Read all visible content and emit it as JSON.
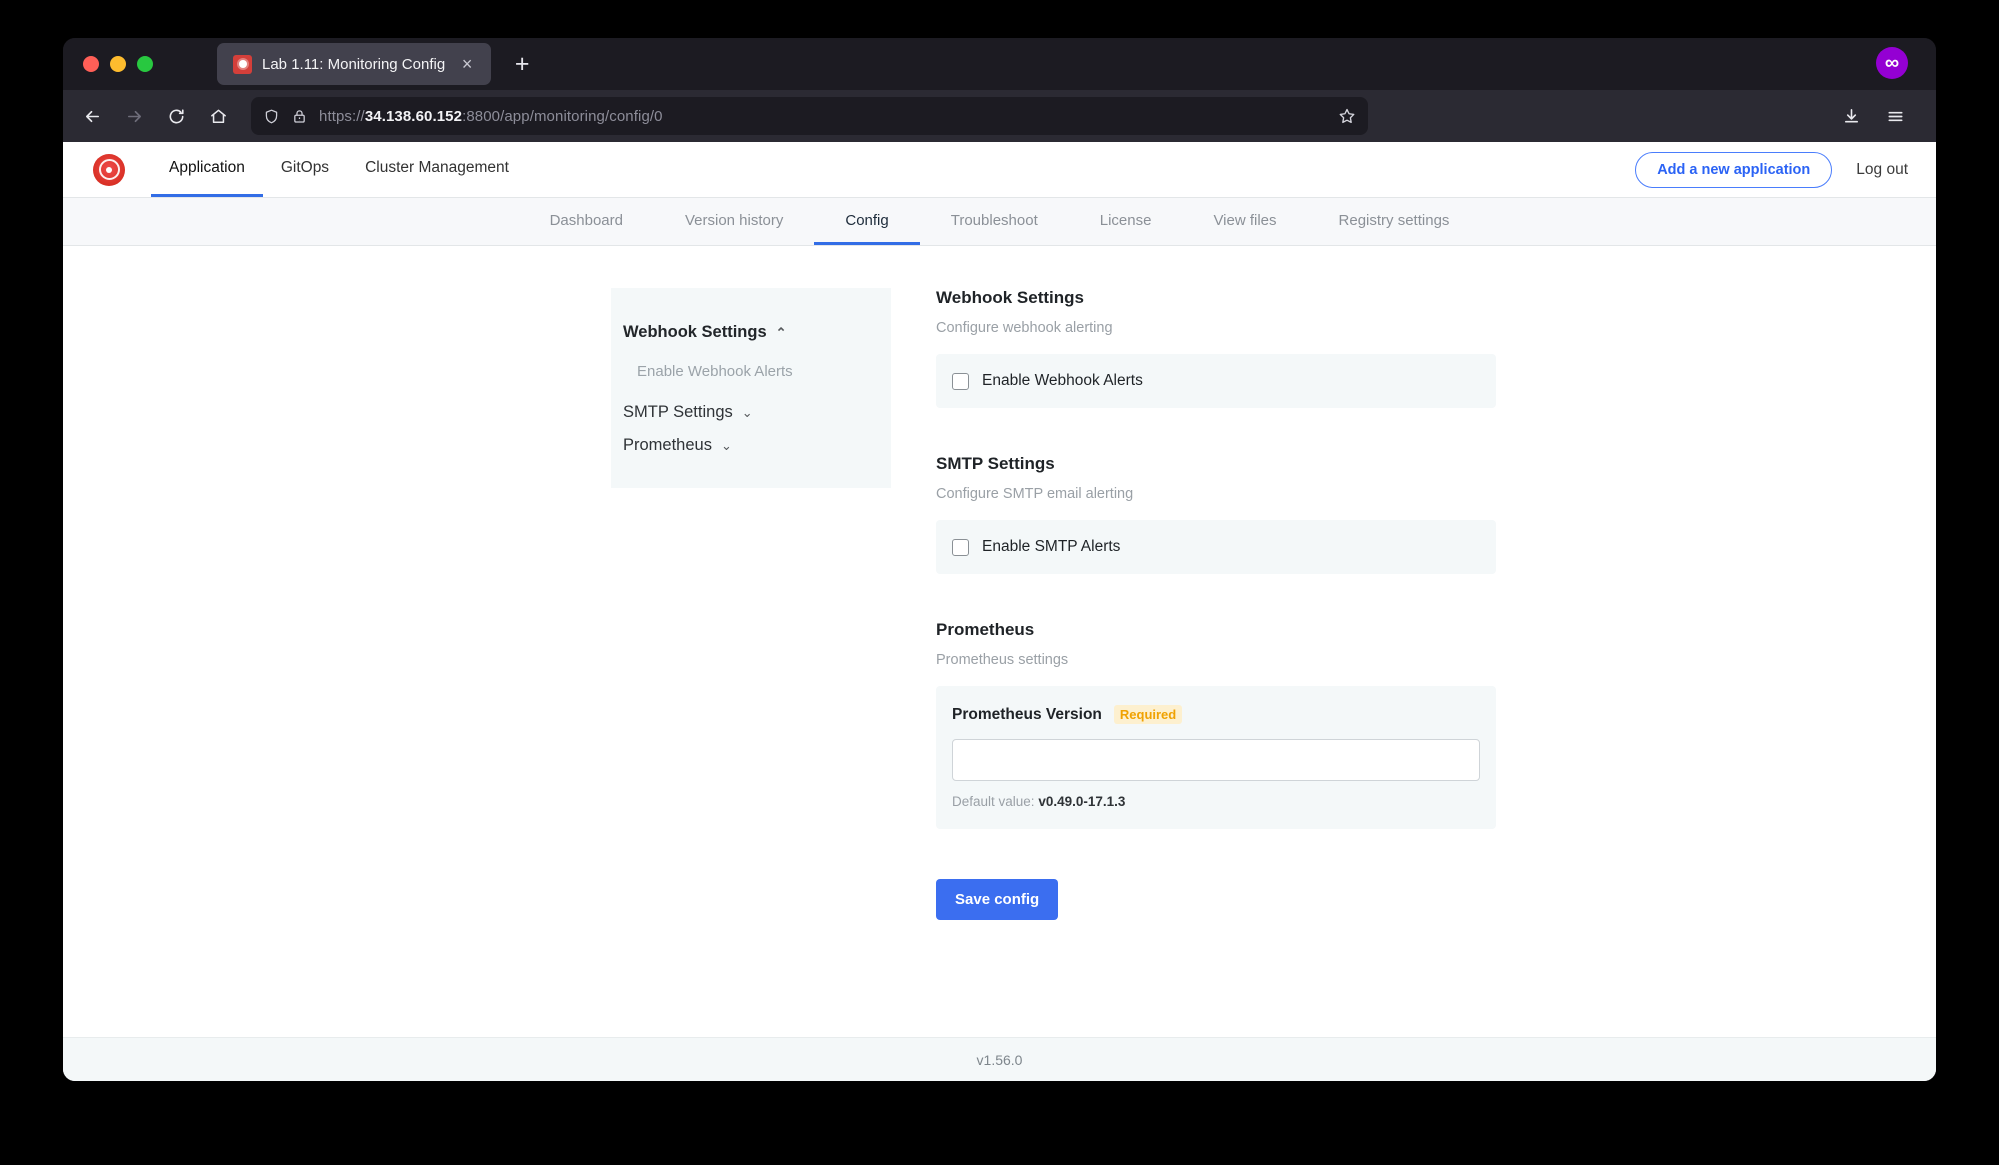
{
  "browser": {
    "tab": {
      "title": "Lab 1.11: Monitoring Config",
      "close_label": "×",
      "favicon_name": "alarm-siren-favicon"
    },
    "new_tab_label": "+",
    "profile_badge_label": "∞",
    "toolbar": {
      "back_label": "←",
      "forward_label": "→",
      "reload_label": "↻",
      "home_label": "⌂",
      "url_scheme": "https://",
      "url_host": "34.138.60.152",
      "url_rest": ":8800/app/monitoring/config/0",
      "url_full": "https://34.138.60.152:8800/app/monitoring/config/0",
      "bookmark_label": "☆",
      "download_label": "↓",
      "menu_label": "☰"
    }
  },
  "app": {
    "logo_name": "kots-alarm-logo",
    "nav": [
      {
        "label": "Application",
        "active": true
      },
      {
        "label": "GitOps",
        "active": false
      },
      {
        "label": "Cluster Management",
        "active": false
      }
    ],
    "add_application_label": "Add a new application",
    "logout_label": "Log out",
    "subtabs": [
      {
        "label": "Dashboard",
        "active": false
      },
      {
        "label": "Version history",
        "active": false
      },
      {
        "label": "Config",
        "active": true
      },
      {
        "label": "Troubleshoot",
        "active": false
      },
      {
        "label": "License",
        "active": false
      },
      {
        "label": "View files",
        "active": false
      },
      {
        "label": "Registry settings",
        "active": false
      }
    ],
    "footer_version": "v1.56.0"
  },
  "side_panel": {
    "groups": [
      {
        "label": "Webhook Settings",
        "chevron": "⌃",
        "expanded": true,
        "items": [
          {
            "label": "Enable Webhook Alerts"
          }
        ]
      },
      {
        "label": "SMTP Settings",
        "chevron": "⌄",
        "expanded": false,
        "items": []
      },
      {
        "label": "Prometheus",
        "chevron": "⌄",
        "expanded": false,
        "items": []
      }
    ]
  },
  "config": {
    "sections": [
      {
        "title": "Webhook Settings",
        "description": "Configure webhook alerting",
        "checkbox_label": "Enable Webhook Alerts",
        "checked": false
      },
      {
        "title": "SMTP Settings",
        "description": "Configure SMTP email alerting",
        "checkbox_label": "Enable SMTP Alerts",
        "checked": false
      }
    ],
    "prometheus": {
      "title": "Prometheus",
      "description": "Prometheus settings",
      "field_label": "Prometheus Version",
      "required_badge": "Required",
      "input_value": "",
      "input_placeholder": "",
      "default_prefix": "Default value:",
      "default_value": "v0.49.0-17.1.3"
    },
    "save_label": "Save config"
  },
  "colors": {
    "accent_blue": "#326de6",
    "button_blue": "#3b6ef0",
    "required_amber": "#f0a202",
    "logo_red": "#d93025",
    "panel_bg": "#f4f8f9"
  }
}
